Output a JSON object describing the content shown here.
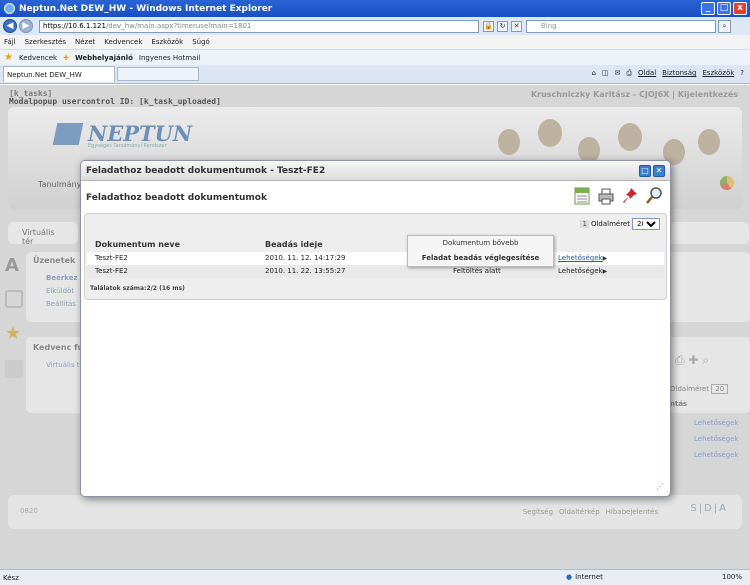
{
  "window": {
    "title": "Neptun.Net DEW_HW - Windows Internet Explorer",
    "btn_min": "_",
    "btn_max": "□",
    "btn_close": "x"
  },
  "browser": {
    "url_main": "https://10.6.1.121",
    "url_rest": "/dev_hw/main.aspx?timeruselmain=1801",
    "search_placeholder": "Bing",
    "menu": [
      "Fájl",
      "Szerkesztés",
      "Nézet",
      "Kedvencek",
      "Eszközök",
      "Súgó"
    ],
    "favorites": {
      "label": "Kedvencek",
      "web": "Webhelyajánló",
      "hotmail": "Ingyenes Hotmail"
    },
    "tab_label": "Neptun.Net DEW_HW",
    "cmd": [
      "Oldal",
      "Biztonság",
      "Eszközök"
    ],
    "status_left": "Kész",
    "status_zone": "Internet",
    "status_zoom": "100%"
  },
  "page": {
    "header_tasks": "[k_tasks]",
    "header_modal": "Modalpopup usercontrol ID: [k_task_uploaded]",
    "user_info": "Kruschniczky Karitász - CJOJ6X",
    "logout": "Kijelentkezés",
    "logo": "NEPTUN",
    "logo_sub": "Egységes Tanulmányi Rendszer",
    "tanulmany": "Tanulmány",
    "virtual": "Virtuális tér",
    "messages": "Üzenetek",
    "side_items": [
      "Beérkez",
      "Elküldöt",
      "Beállítás"
    ],
    "favorites_section": "Kedvenc fun",
    "fav_item": "Virtuális t",
    "bg_pagesize": "Oldalméret",
    "bg_pagesize_val": "20",
    "bg_links": [
      "Lehetőségek",
      "Lehetőségek",
      "Lehetőségek"
    ],
    "bg_text": "ntás",
    "footer_links": [
      "Segítség",
      "Oldaltérkép",
      "Hibabejelentés"
    ],
    "footer_left": "0820",
    "footer_right": "S|D|A"
  },
  "modal": {
    "title": "Feladathoz beadott dokumentumok - Teszt-FE2",
    "heading": "Feladathoz beadott dokumentumok",
    "page_num": "1",
    "page_size_label": "Oldalméret",
    "page_size_value": "20",
    "columns": {
      "name": "Dokumentum neve",
      "date": "Beadás ideje"
    },
    "rows": [
      {
        "name": "Teszt-FE2",
        "date": "2010. 11. 12. 14:17:29",
        "status": "",
        "options": "Lehetőségek"
      },
      {
        "name": "Teszt-FE2",
        "date": "2010. 11. 22. 13:55:27",
        "status": "Feltöltés alatt",
        "options": "Lehetőségek"
      }
    ],
    "results": "Találatok száma:2/2 (16 ms)",
    "context_menu": [
      "Dokumentum bővebb",
      "Feladat beadás véglegesítése"
    ]
  }
}
